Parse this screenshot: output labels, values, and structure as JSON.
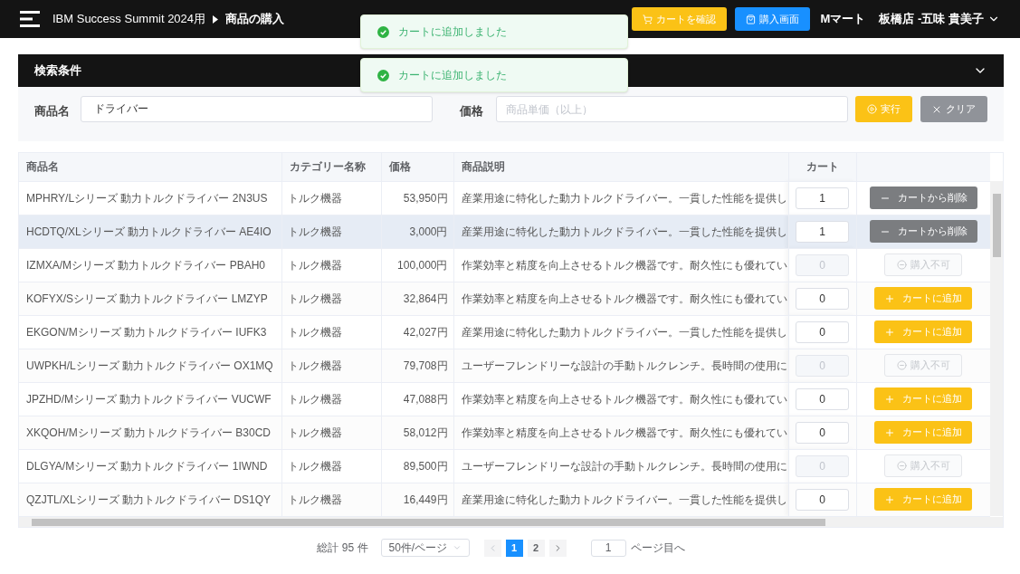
{
  "header": {
    "breadcrumb": [
      "IBM Success Summit 2024用",
      "商品の購入"
    ],
    "cart_button": "カートを確認",
    "purchase_button": "購入画面",
    "store": "Mマート",
    "user": "板橋店 -五味 貴美子"
  },
  "toasts": [
    "カートに追加しました",
    "カートに追加しました"
  ],
  "search": {
    "title": "検索条件",
    "expanded": true,
    "name_label": "商品名",
    "name_value": "ドライバー",
    "price_label": "価格",
    "price_placeholder": "商品単価（以上）",
    "run_button": "実行",
    "clear_button": "クリア"
  },
  "table": {
    "columns": [
      "商品名",
      "カテゴリー名称",
      "価格",
      "商品説明",
      "カート"
    ],
    "rows": [
      {
        "name": "MPHRY/Lシリーズ 動力トルクドライバー 2N3US",
        "category": "トルク機器",
        "price": "53,950円",
        "description": "産業用途に特化した動力トルクドライバー。一貫した性能を提供し",
        "qty": "1",
        "kind": "remove",
        "action": "カートから削除",
        "highlighted": false
      },
      {
        "name": "HCDTQ/XLシリーズ 動力トルクドライバー AE4IO",
        "category": "トルク機器",
        "price": "3,000円",
        "description": "産業用途に特化した動力トルクドライバー。一貫した性能を提供し",
        "qty": "1",
        "kind": "remove",
        "action": "カートから削除",
        "highlighted": true
      },
      {
        "name": "IZMXA/Mシリーズ 動力トルクドライバー PBAH0",
        "category": "トルク機器",
        "price": "100,000円",
        "description": "作業効率と精度を向上させるトルク機器です。耐久性にも優れてい",
        "qty": "0",
        "kind": "unavailable",
        "action": "購入不可",
        "highlighted": false
      },
      {
        "name": "KOFYX/Sシリーズ 動力トルクドライバー LMZYP",
        "category": "トルク機器",
        "price": "32,864円",
        "description": "作業効率と精度を向上させるトルク機器です。耐久性にも優れてい",
        "qty": "0",
        "kind": "add",
        "action": "カートに追加",
        "highlighted": false
      },
      {
        "name": "EKGON/Mシリーズ 動力トルクドライバー IUFK3",
        "category": "トルク機器",
        "price": "42,027円",
        "description": "産業用途に特化した動力トルクドライバー。一貫した性能を提供し",
        "qty": "0",
        "kind": "add",
        "action": "カートに追加",
        "highlighted": false
      },
      {
        "name": "UWPKH/Lシリーズ 動力トルクドライバー OX1MQ",
        "category": "トルク機器",
        "price": "79,708円",
        "description": "ユーザーフレンドリーな設計の手動トルクレンチ。長時間の使用に",
        "qty": "0",
        "kind": "unavailable",
        "action": "購入不可",
        "highlighted": false
      },
      {
        "name": "JPZHD/Mシリーズ 動力トルクドライバー VUCWF",
        "category": "トルク機器",
        "price": "47,088円",
        "description": "作業効率と精度を向上させるトルク機器です。耐久性にも優れてい",
        "qty": "0",
        "kind": "add",
        "action": "カートに追加",
        "highlighted": false
      },
      {
        "name": "XKQOH/Mシリーズ 動力トルクドライバー B30CD",
        "category": "トルク機器",
        "price": "58,012円",
        "description": "作業効率と精度を向上させるトルク機器です。耐久性にも優れてい",
        "qty": "0",
        "kind": "add",
        "action": "カートに追加",
        "highlighted": false
      },
      {
        "name": "DLGYA/Mシリーズ 動力トルクドライバー 1IWND",
        "category": "トルク機器",
        "price": "89,500円",
        "description": "ユーザーフレンドリーな設計の手動トルクレンチ。長時間の使用に",
        "qty": "0",
        "kind": "unavailable",
        "action": "購入不可",
        "highlighted": false
      },
      {
        "name": "QZJTL/XLシリーズ 動力トルクドライバー DS1QY",
        "category": "トルク機器",
        "price": "16,449円",
        "description": "産業用途に特化した動力トルクドライバー。一貫した性能を提供し",
        "qty": "0",
        "kind": "add",
        "action": "カートに追加",
        "highlighted": false
      }
    ]
  },
  "pagination": {
    "total": "総計 95 件",
    "page_size": "50件/ページ",
    "pages": [
      {
        "label": "1",
        "selected": true
      },
      {
        "label": "2",
        "selected": false
      }
    ],
    "jump_value": "1",
    "jump_label": "ページ目へ"
  }
}
